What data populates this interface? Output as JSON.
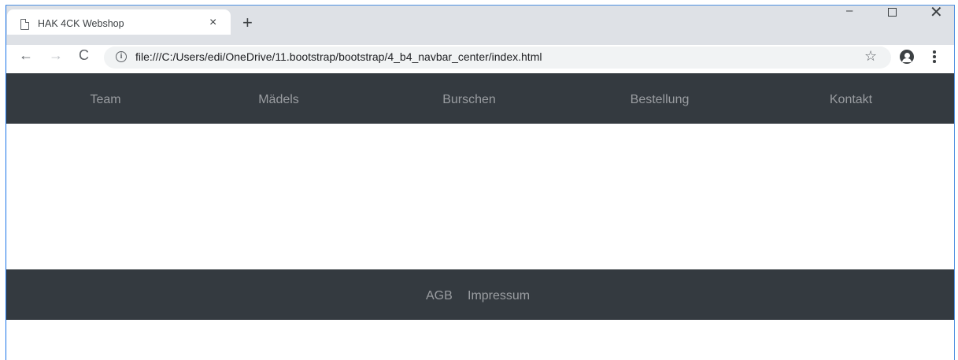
{
  "browser": {
    "tab": {
      "title": "HAK 4CK Webshop",
      "close_glyph": "×",
      "icon": "document-icon"
    },
    "new_tab_glyph": "+",
    "window_controls": {
      "minimize_glyph": "–",
      "close_glyph": "✕"
    },
    "toolbar": {
      "back_glyph": "←",
      "forward_glyph": "→",
      "reload_glyph": "C",
      "info_glyph": "i",
      "url": "file:///C:/Users/edi/OneDrive/11.bootstrap/bootstrap/4_b4_navbar_center/index.html",
      "star_glyph": "☆"
    }
  },
  "page": {
    "navbar": {
      "background": "#343a40",
      "link_color": "#9a9da1",
      "items": [
        {
          "label": "Team"
        },
        {
          "label": "Mädels"
        },
        {
          "label": "Burschen"
        },
        {
          "label": "Bestellung"
        },
        {
          "label": "Kontakt"
        }
      ]
    },
    "footer": {
      "items": [
        {
          "label": "AGB"
        },
        {
          "label": "Impressum"
        }
      ]
    }
  }
}
